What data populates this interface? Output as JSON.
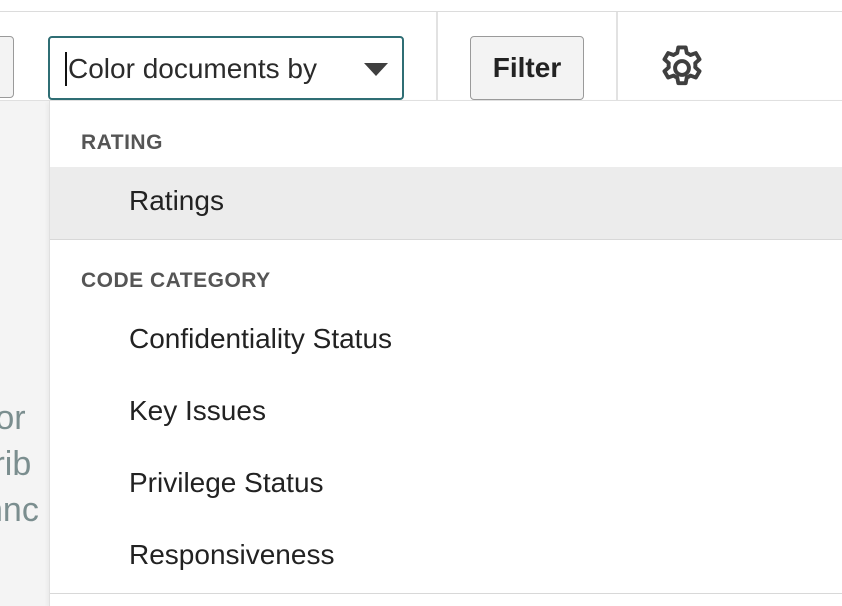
{
  "toolbar": {
    "color_select": {
      "placeholder": "Color documents by",
      "caret_icon": "chevron-down-icon"
    },
    "filter_label": "Filter",
    "settings_icon": "gear-icon"
  },
  "background_fragments": [
    "ror",
    "trib",
    "hnc"
  ],
  "dropdown": {
    "groups": [
      {
        "header": "RATING",
        "items": [
          {
            "label": "Ratings",
            "highlighted": true
          }
        ]
      },
      {
        "header": "CODE CATEGORY",
        "items": [
          {
            "label": "Confidentiality Status",
            "highlighted": false
          },
          {
            "label": "Key Issues",
            "highlighted": false
          },
          {
            "label": "Privilege Status",
            "highlighted": false
          },
          {
            "label": "Responsiveness",
            "highlighted": false
          }
        ]
      }
    ]
  },
  "colors": {
    "select_border": "#2f6e74",
    "highlight_bg": "#ececec",
    "group_header_text": "#555555"
  }
}
